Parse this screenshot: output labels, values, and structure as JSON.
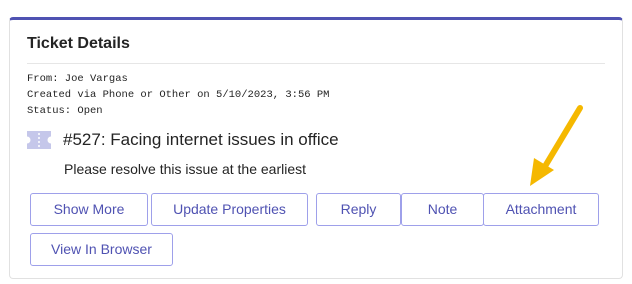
{
  "card": {
    "title": "Ticket Details",
    "accent_color": "#4f52b2"
  },
  "meta": {
    "from_line": "From: Joe Vargas",
    "created_line": "Created via Phone or Other on 5/10/2023, 3:56 PM",
    "status_line": "Status: Open"
  },
  "ticket": {
    "icon": "ticket-icon",
    "title": "#527: Facing internet issues in office",
    "description": "Please resolve this issue at the earliest"
  },
  "actions": {
    "show_more": "Show More",
    "update_properties": "Update Properties",
    "reply": "Reply",
    "note": "Note",
    "attachment": "Attachment",
    "view_in_browser": "View In Browser"
  },
  "annotation": {
    "arrow_icon": "pointer-arrow-icon",
    "arrow_color": "#f5b800"
  }
}
